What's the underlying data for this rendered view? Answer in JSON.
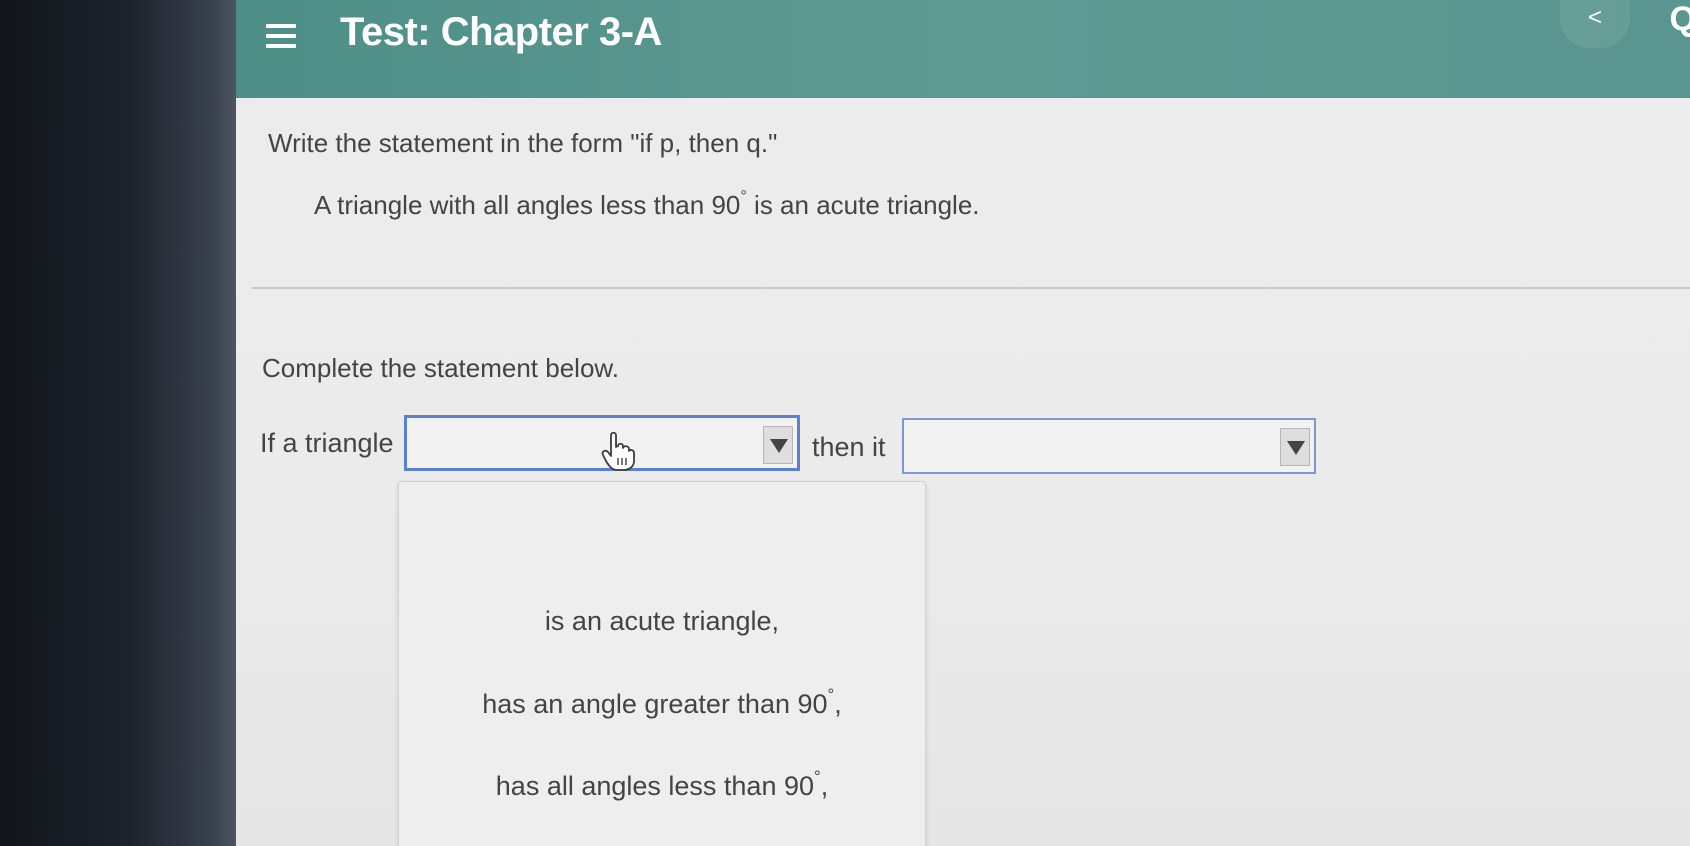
{
  "header": {
    "title": "Test:  Chapter 3-A",
    "back_glyph": "<",
    "edge_text": "Q"
  },
  "question": {
    "instruction": "Write the statement in the form \"if p, then q.\"",
    "statement_before": "A triangle with all angles less than 90",
    "statement_degree": "°",
    "statement_after": " is an acute triangle."
  },
  "answer": {
    "prompt": "Complete the statement below.",
    "lead": "If a triangle",
    "mid": "then it",
    "first_select": {
      "value": "",
      "options": [
        {
          "text": "is an acute triangle,",
          "sup": ""
        },
        {
          "text": "has an angle greater than 90",
          "sup": "°",
          "tail": ","
        },
        {
          "text": "has all angles less than 90",
          "sup": "°",
          "tail": ","
        }
      ]
    },
    "second_select": {
      "value": ""
    }
  },
  "icons": {
    "menu": "hamburger-menu-icon",
    "cursor": "hand-pointer-icon",
    "dropdown_arrow": "triangle-down-icon"
  },
  "colors": {
    "header": "#5e9a92",
    "select_border": "#5b7fd1"
  }
}
